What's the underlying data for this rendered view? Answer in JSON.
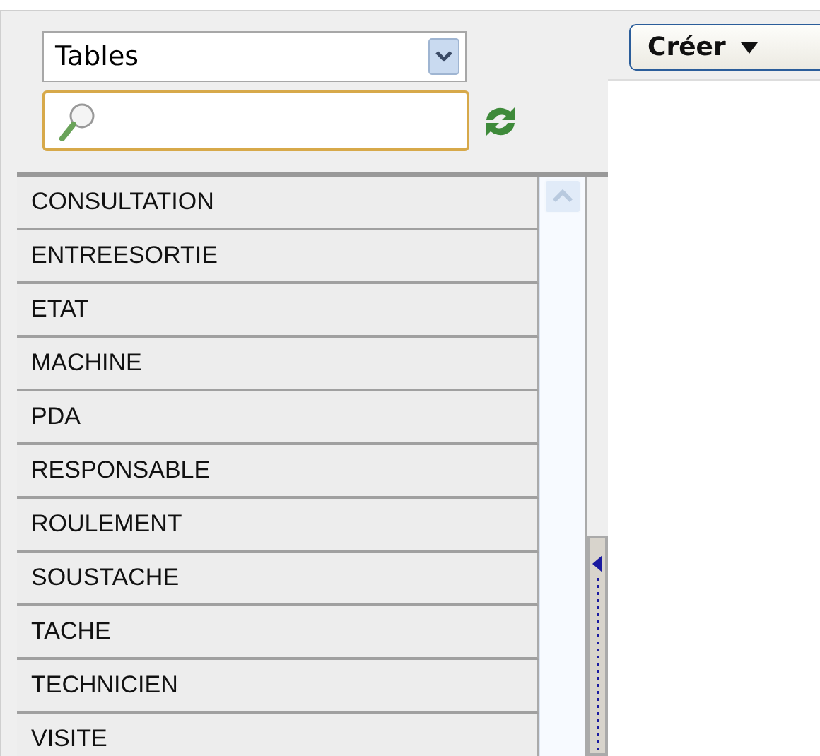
{
  "picker": {
    "value": "Tables"
  },
  "search": {
    "focused": true
  },
  "tables": [
    {
      "label": "CONSULTATION"
    },
    {
      "label": "ENTREESORTIE"
    },
    {
      "label": "ETAT"
    },
    {
      "label": "MACHINE"
    },
    {
      "label": "PDA"
    },
    {
      "label": "RESPONSABLE"
    },
    {
      "label": "ROULEMENT"
    },
    {
      "label": "SOUSTACHE"
    },
    {
      "label": "TACHE"
    },
    {
      "label": "TECHNICIEN"
    },
    {
      "label": "VISITE"
    }
  ],
  "toolbar": {
    "create_button": "Créer"
  }
}
